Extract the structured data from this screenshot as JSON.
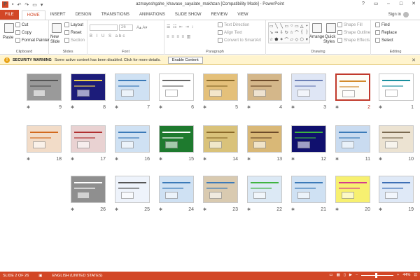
{
  "window": {
    "title": "azmayeshgahe_khavase_sayalate_makhzan [Compatibility Mode] - PowerPoint",
    "controls": [
      "?",
      "▭",
      "–",
      "□",
      "✕"
    ]
  },
  "tabs": [
    "FILE",
    "HOME",
    "INSERT",
    "DESIGN",
    "TRANSITIONS",
    "ANIMATIONS",
    "SLIDE SHOW",
    "REVIEW",
    "VIEW"
  ],
  "active_tab": "HOME",
  "signin": "Sign in",
  "ribbon": {
    "clipboard": {
      "label": "Clipboard",
      "paste": "Paste",
      "cut": "Cut",
      "copy": "Copy",
      "format_painter": "Format Painter"
    },
    "slides": {
      "label": "Slides",
      "new_slide": "New",
      "new_slide2": "Slide",
      "layout": "Layout",
      "reset": "Reset",
      "section": "Section"
    },
    "font": {
      "label": "Font",
      "size": "26"
    },
    "paragraph": {
      "label": "Paragraph",
      "text_direction": "Text Direction",
      "align_text": "Align Text",
      "smartart": "Convert to SmartArt"
    },
    "drawing": {
      "label": "Drawing",
      "arrange": "Arrange",
      "quick_styles": "Quick",
      "quick_styles2": "Styles",
      "shape_fill": "Shape Fill",
      "shape_outline": "Shape Outline",
      "shape_effects": "Shape Effects"
    },
    "editing": {
      "label": "Editing",
      "find": "Find",
      "replace": "Replace",
      "select": "Select"
    }
  },
  "security": {
    "title": "SECURITY WARNING",
    "message": "Some active content has been disabled. Click for more details.",
    "button": "Enable Content"
  },
  "slides": [
    {
      "n": "1",
      "bg": "#ffffff",
      "accent": "#1a8f9e"
    },
    {
      "n": "2",
      "bg": "#fdfdf8",
      "accent": "#d28b2b",
      "selected": true
    },
    {
      "n": "3",
      "bg": "#dfe6f5",
      "accent": "#6c7fb5"
    },
    {
      "n": "4",
      "bg": "#d4b78a",
      "accent": "#6d4b2a"
    },
    {
      "n": "5",
      "bg": "#e4c07a",
      "accent": "#8a6a2a"
    },
    {
      "n": "6",
      "bg": "#ffffff",
      "accent": "#666666"
    },
    {
      "n": "7",
      "bg": "#cfe1f3",
      "accent": "#3b7ab8"
    },
    {
      "n": "8",
      "bg": "#1c1c7a",
      "accent": "#f0d24b"
    },
    {
      "n": "9",
      "bg": "#9a9a9a",
      "accent": "#555555"
    },
    {
      "n": "10",
      "bg": "#ece3d2",
      "accent": "#7a6a50"
    },
    {
      "n": "11",
      "bg": "#c9dbf0",
      "accent": "#3b7ab8"
    },
    {
      "n": "12",
      "bg": "#10106e",
      "accent": "#3fb33f"
    },
    {
      "n": "13",
      "bg": "#d9b877",
      "accent": "#6d4b2a"
    },
    {
      "n": "14",
      "bg": "#d9c27a",
      "accent": "#8a6a2a"
    },
    {
      "n": "15",
      "bg": "#1e7a2e",
      "accent": "#ffffff"
    },
    {
      "n": "16",
      "bg": "#cfe1f3",
      "accent": "#3b7ab8"
    },
    {
      "n": "17",
      "bg": "#e9d2d2",
      "accent": "#b03030"
    },
    {
      "n": "18",
      "bg": "#f2dcc8",
      "accent": "#d2691e"
    },
    {
      "n": "19",
      "bg": "#dfe9f7",
      "accent": "#3d6fb5"
    },
    {
      "n": "20",
      "bg": "#f7f070",
      "accent": "#d43c8c"
    },
    {
      "n": "21",
      "bg": "#cfe1f3",
      "accent": "#3b7ab8"
    },
    {
      "n": "22",
      "bg": "#dce9f5",
      "accent": "#3fb33f"
    },
    {
      "n": "23",
      "bg": "#d9cab0",
      "accent": "#3b7ab8"
    },
    {
      "n": "24",
      "bg": "#cfe1f3",
      "accent": "#3b7ab8"
    },
    {
      "n": "25",
      "bg": "#eef3fb",
      "accent": "#555555"
    },
    {
      "n": "26",
      "bg": "#8f8f8f",
      "accent": "#ffffff"
    }
  ],
  "status": {
    "slide": "SLIDE 2 OF 26",
    "language": "ENGLISH (UNITED STATES)",
    "zoom": "44%"
  }
}
